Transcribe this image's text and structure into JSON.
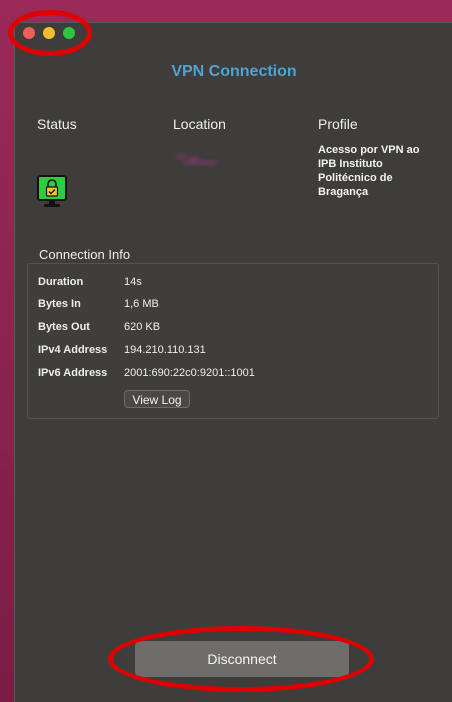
{
  "window": {
    "controls": [
      "close",
      "minimize",
      "zoom"
    ],
    "title": "VPN Connection"
  },
  "columns": {
    "status_label": "Status",
    "location_label": "Location",
    "profile_label": "Profile"
  },
  "status": {
    "icon": "connected-lock-monitor-icon",
    "icon_color": "#2ecc40"
  },
  "profile": {
    "name": "Acesso por VPN ao IPB Instituto Politécnico de Bragança"
  },
  "connection_info": {
    "label": "Connection Info",
    "rows": [
      {
        "key": "Duration",
        "value": "14s"
      },
      {
        "key": "Bytes In",
        "value": "1,6 MB"
      },
      {
        "key": "Bytes Out",
        "value": "620 KB"
      },
      {
        "key": "IPv4 Address",
        "value": "194.210.110.131"
      },
      {
        "key": "IPv6 Address",
        "value": "2001:690:22c0:9201::1001"
      }
    ],
    "view_log_label": "View Log"
  },
  "actions": {
    "disconnect_label": "Disconnect"
  },
  "annotations": {
    "callout_color": "#e00000"
  }
}
